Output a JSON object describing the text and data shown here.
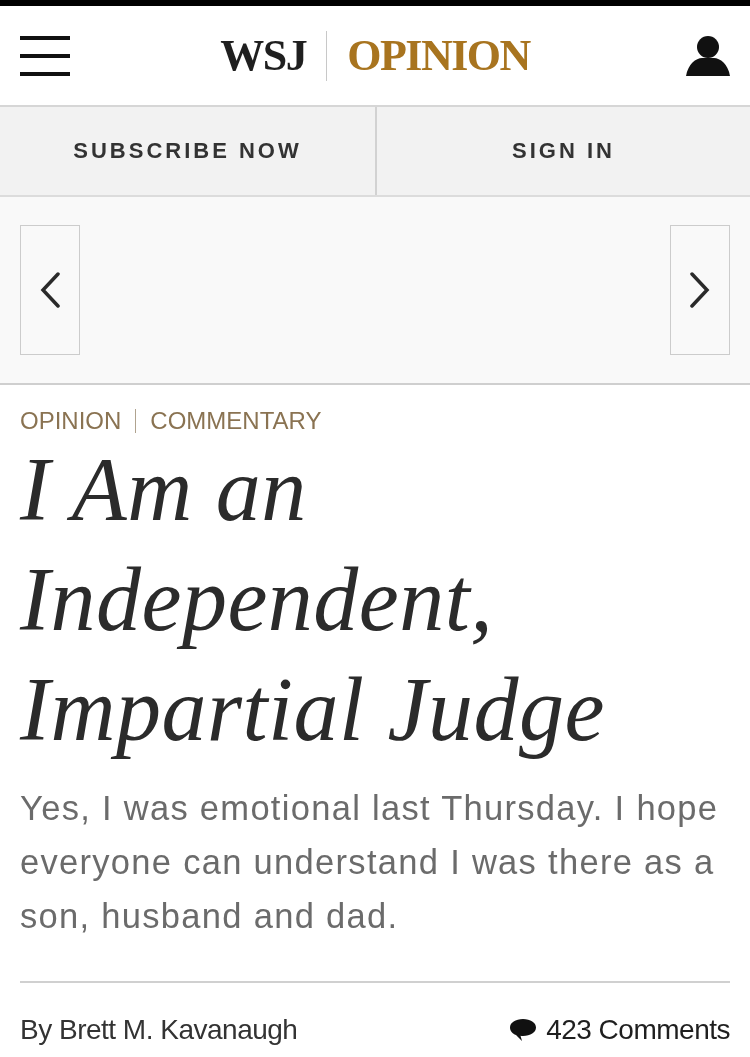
{
  "header": {
    "logo_primary": "WSJ",
    "logo_section": "OPINION"
  },
  "account_buttons": [
    {
      "label": "SUBSCRIBE NOW"
    },
    {
      "label": "SIGN IN"
    }
  ],
  "article": {
    "sections": [
      "OPINION",
      "COMMENTARY"
    ],
    "headline": "I Am an Independent, Impartial Judge",
    "dek": "Yes, I was emotional last Thursday. I hope everyone can understand I was there as a son, husband and dad.",
    "byline": "By Brett M. Kavanaugh",
    "comments": "423 Comments"
  }
}
